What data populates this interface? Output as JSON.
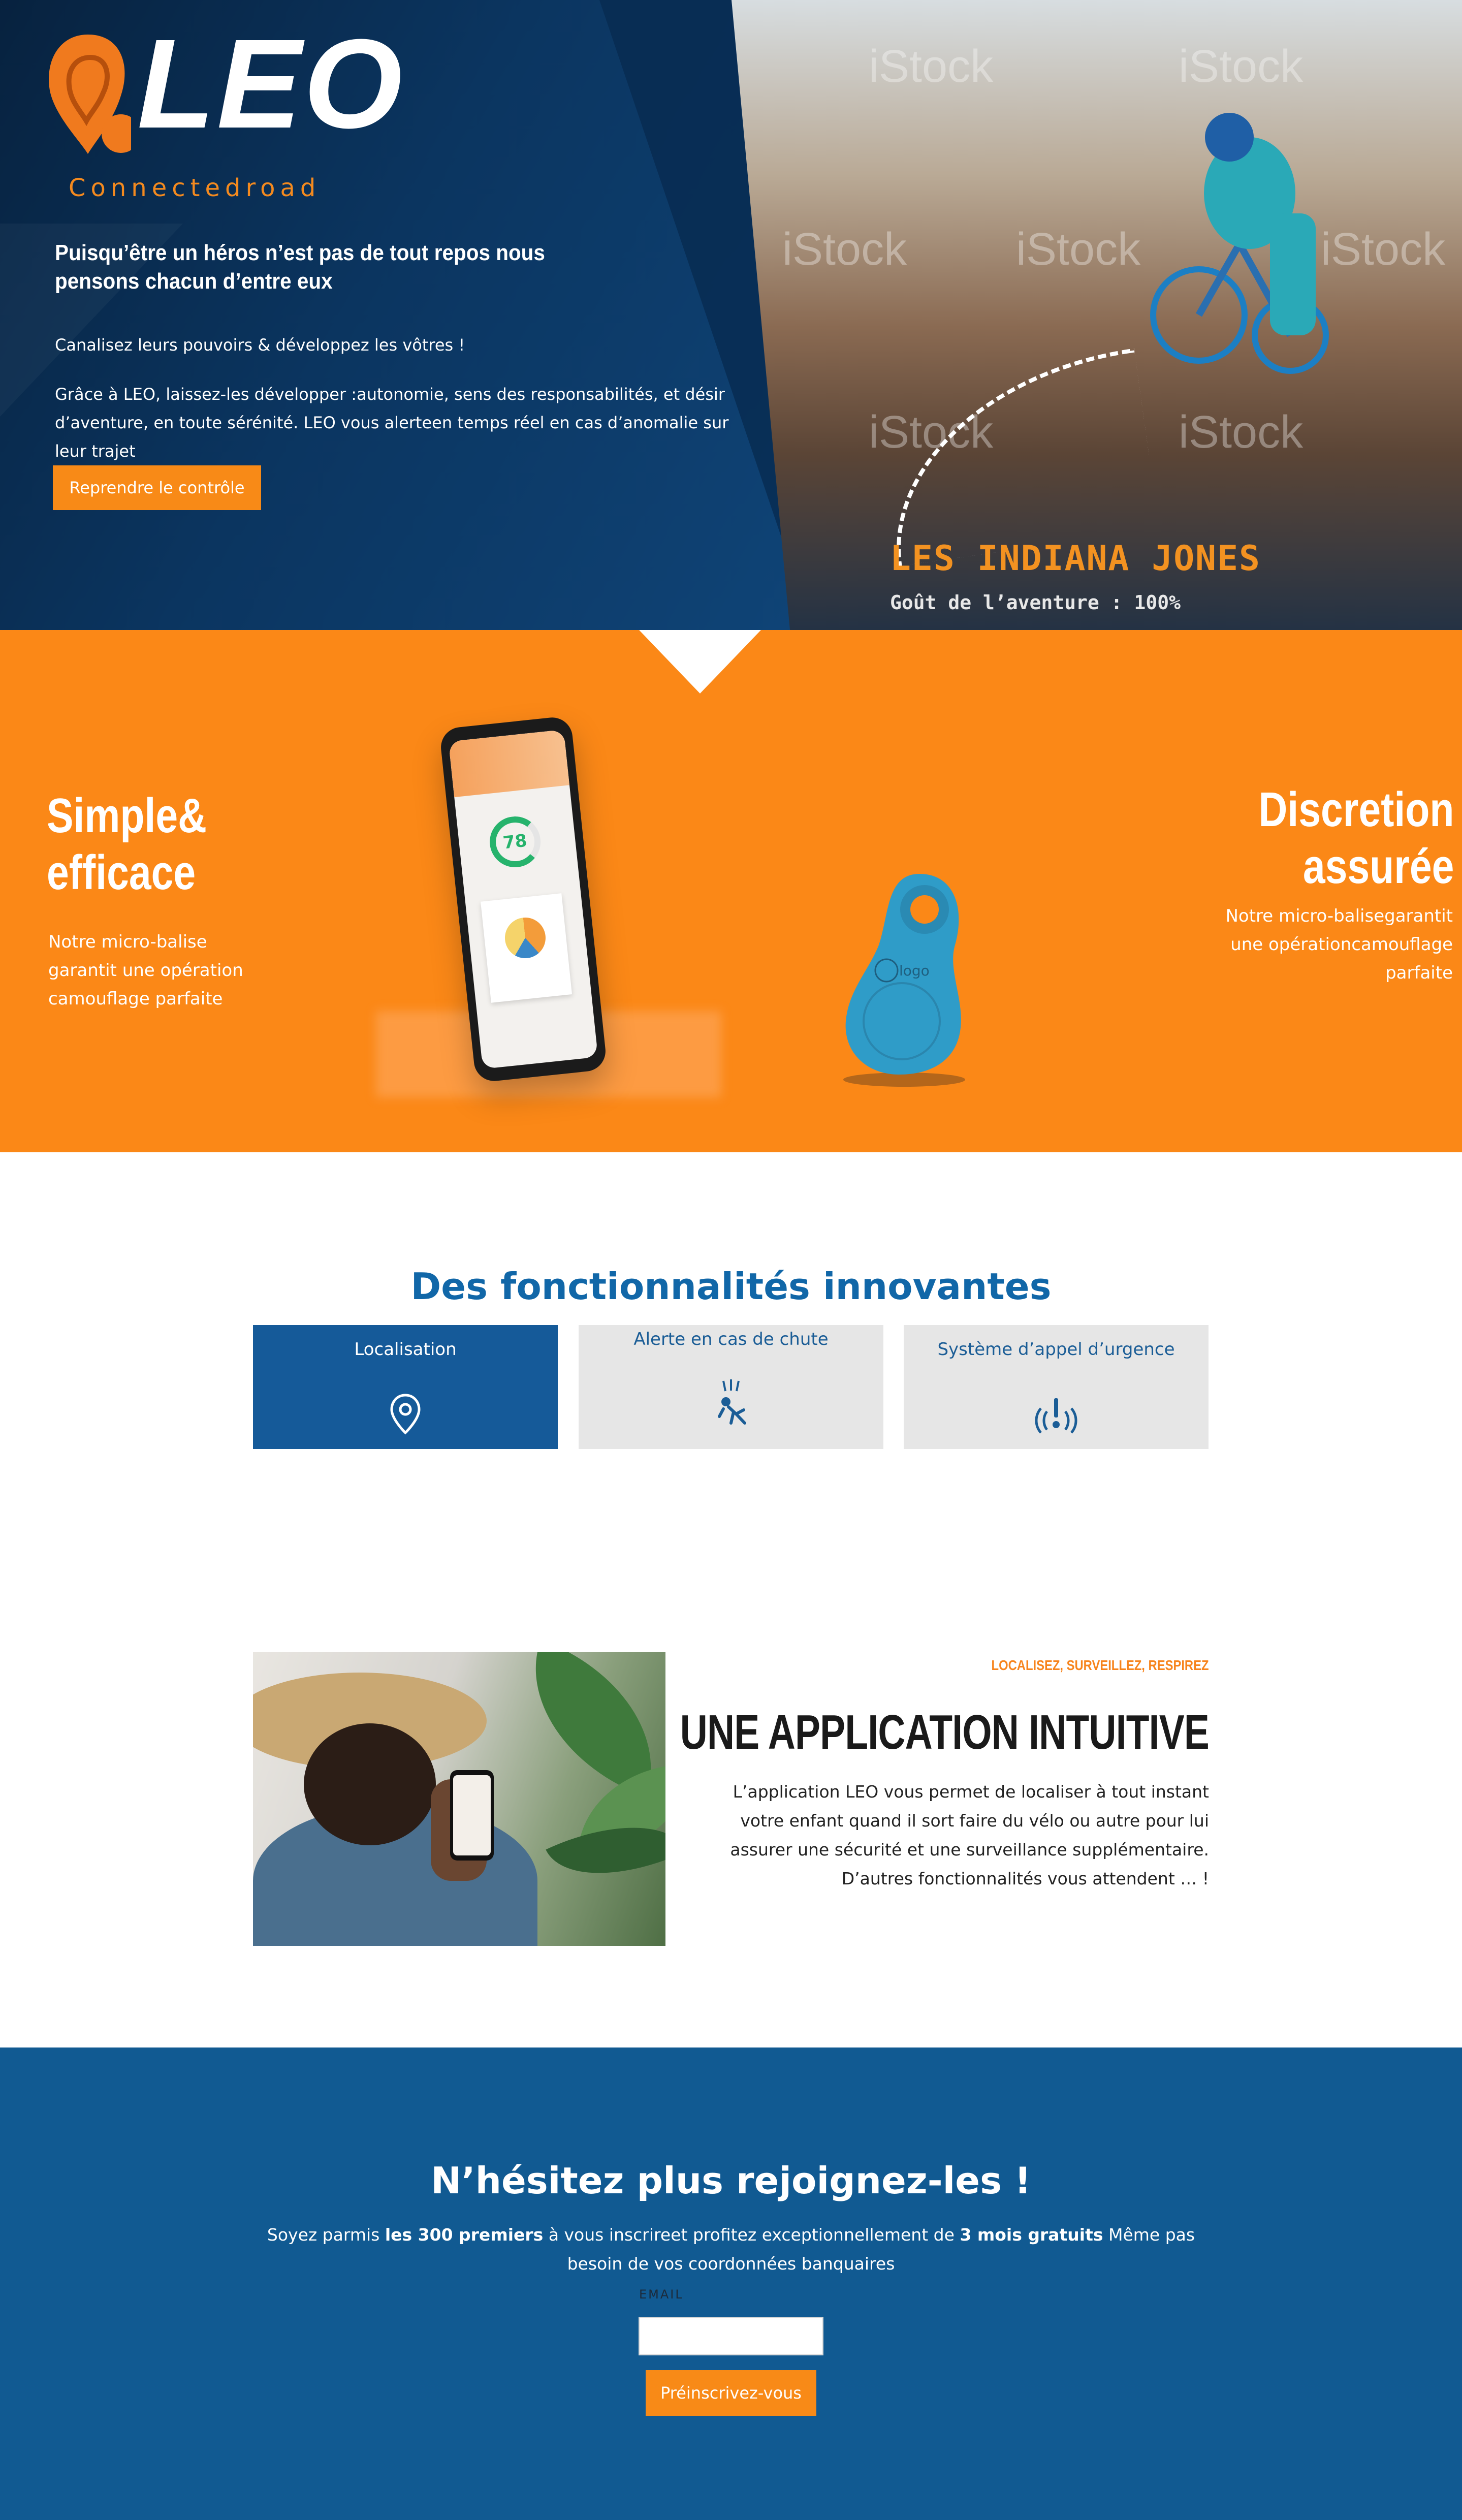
{
  "brand": {
    "name": "LEO",
    "tagline": "Connectedroad",
    "accent_color": "#f88a17",
    "primary_color": "#115a92"
  },
  "hero": {
    "headline": "Puisqu’être un héros n’est pas de tout repos nous pensons chacun d’entre eux",
    "tagline": "Canalisez leurs pouvoirs & développez les vôtres !",
    "body": "Grâce à LEO, laissez-les développer :autonomie, sens des responsabilités, et désir d’aventure, en toute sérénité. LEO vous alerteen temps réel en cas d’anomalie sur leur trajet",
    "cta_label": "Reprendre le contrôle",
    "image": {
      "overlay_title": "LES INDIANA JONES",
      "overlay_subtitle": "Goût de l’aventure : 100%",
      "watermark": "iStock"
    }
  },
  "features_top": {
    "left": {
      "title_line1": "Simple&",
      "title_line2": "efficace",
      "text": "Notre micro-balise garantit une opération camouflage parfaite"
    },
    "right": {
      "title_line1": "Discretion",
      "title_line2": "assurée",
      "text": "Notre micro-balisegarantit une opérationcamouflage parfaite"
    },
    "phone_score": "78",
    "tag_logo": "logo"
  },
  "functions": {
    "title": "Des fonctionnalités innovantes",
    "items": [
      {
        "label": "Localisation",
        "icon": "location-pin-icon"
      },
      {
        "label": "Alerte en cas de chute",
        "icon": "fall-alert-icon"
      },
      {
        "label": "Système d’appel d’urgence",
        "icon": "emergency-call-icon"
      }
    ]
  },
  "app": {
    "kicker": "LOCALISEZ, SURVEILLEZ, RESPIREZ",
    "title": "UNE APPLICATION INTUITIVE",
    "text": "L’application LEO vous permet de localiser à tout instant votre enfant quand il sort faire du vélo ou autre pour lui assurer une sécurité et une surveillance supplémentaire. D’autres fonctionnalités vous attendent … !"
  },
  "join": {
    "title": "N’hésitez plus rejoignez-les !",
    "text_part1": "Soyez parmis ",
    "text_bold1": "les 300 premiers",
    "text_part2": " à vous inscrireet profitez exceptionnellement de ",
    "text_bold2": "3 mois gratuits",
    "text_part3": " Même pas besoin de vos coordonnées banquaires",
    "email_label": "EMAIL",
    "email_value": "",
    "button_label": "Préinscrivez-vous"
  }
}
